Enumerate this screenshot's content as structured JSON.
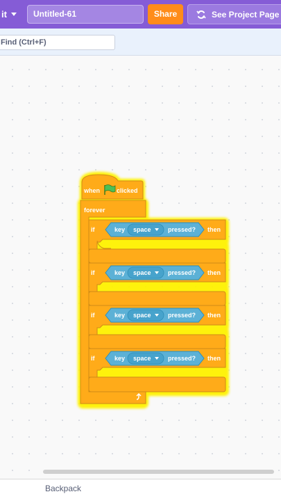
{
  "menu": {
    "edit_label": "it",
    "project_title": "Untitled-61",
    "share_label": "Share",
    "see_project_label": "See Project Page"
  },
  "find": {
    "placeholder": "Find (Ctrl+F)"
  },
  "script": {
    "hat": {
      "when": "when",
      "clicked": "clicked"
    },
    "forever_label": "forever",
    "if_blocks": [
      {
        "if_label": "if",
        "key_label": "key",
        "key_value": "space",
        "pressed_label": "pressed?",
        "then_label": "then"
      },
      {
        "if_label": "if",
        "key_label": "key",
        "key_value": "space",
        "pressed_label": "pressed?",
        "then_label": "then"
      },
      {
        "if_label": "if",
        "key_label": "key",
        "key_value": "space",
        "pressed_label": "pressed?",
        "then_label": "then"
      },
      {
        "if_label": "if",
        "key_label": "key",
        "key_value": "space",
        "pressed_label": "pressed?",
        "then_label": "then"
      }
    ]
  },
  "colors": {
    "menubar": "#855cd6",
    "control": "#ffab19",
    "sensing": "#5cb1d6",
    "glow": "#fff200",
    "share": "#ff8c1a"
  },
  "backpack": {
    "label": "Backpack"
  }
}
